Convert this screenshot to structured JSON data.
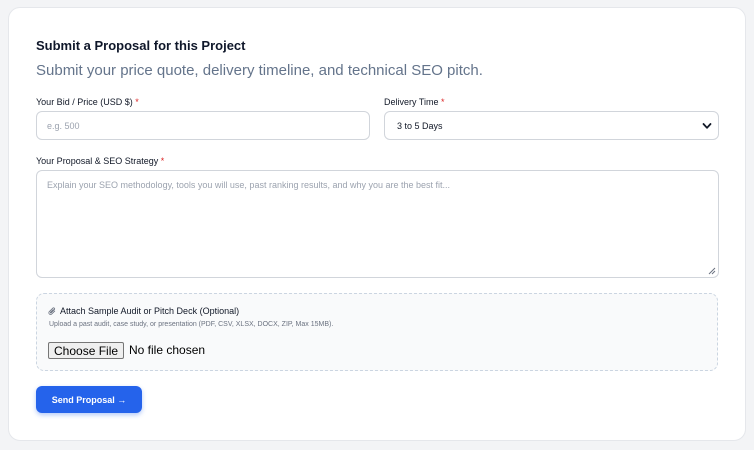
{
  "form": {
    "title": "Submit a Proposal for this Project",
    "subtitle": "Submit your price quote, delivery timeline, and technical SEO pitch.",
    "required_marker": "*",
    "bid": {
      "label": "Your Bid / Price (USD $)",
      "placeholder": "e.g. 500",
      "value": ""
    },
    "delivery": {
      "label": "Delivery Time",
      "selected": "3 to 5 Days",
      "icon": "chevron-down-icon"
    },
    "proposal": {
      "label": "Your Proposal & SEO Strategy",
      "placeholder": "Explain your SEO methodology, tools you will use, past ranking results, and why you are the best fit...",
      "value": ""
    },
    "attachment": {
      "icon": "paperclip-icon",
      "title": "Attach Sample Audit or Pitch Deck (Optional)",
      "hint": "Upload a past audit, case study, or presentation (PDF, CSV, XLSX, DOCX, ZIP, Max 15MB).",
      "button_label": "Choose File",
      "status": "No file chosen"
    },
    "submit_label": "Send Proposal →"
  },
  "colors": {
    "accent": "#2563eb",
    "required": "#dc2626",
    "subtitle": "#64748b"
  }
}
